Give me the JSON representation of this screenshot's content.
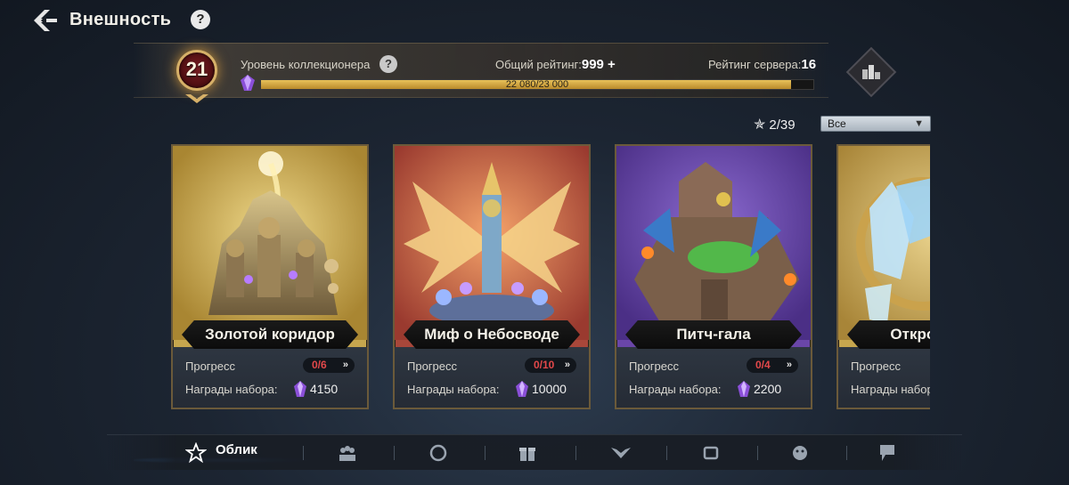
{
  "header": {
    "title": "Внешность",
    "help": "?"
  },
  "collector": {
    "level": "21",
    "label": "Уровень коллекционера",
    "help": "?",
    "overall_rating_label": "Общий рейтинг:",
    "overall_rating_value": "999 +",
    "server_rating_label": "Рейтинг сервера:",
    "server_rating_value": "16",
    "xp_text": "22 080/23 000",
    "xp_progress": 0.96
  },
  "filter": {
    "counter": "2/39",
    "selected": "Все"
  },
  "cards": [
    {
      "name": "Золотой коридор",
      "progress_label": "Прогресс",
      "progress": "0/6",
      "rewards_label": "Награды набора:",
      "reward_value": "4150",
      "theme": "gold"
    },
    {
      "name": "Миф о Небосводе",
      "progress_label": "Прогресс",
      "progress": "0/10",
      "rewards_label": "Награды набора:",
      "reward_value": "10000",
      "theme": "red"
    },
    {
      "name": "Питч-гала",
      "progress_label": "Прогресс",
      "progress": "0/4",
      "rewards_label": "Награды набора:",
      "reward_value": "2200",
      "theme": "purple"
    },
    {
      "name": "Откровения",
      "progress_label": "Прогресс",
      "progress": "",
      "rewards_label": "Награды набора:",
      "reward_value": "",
      "theme": "gold"
    }
  ],
  "nav": {
    "active_label": "Облик",
    "tabs": [
      "star-tab-icon",
      "crowd-tab-icon",
      "ring-tab-icon",
      "gift-tab-icon",
      "wings-tab-icon",
      "frame-tab-icon",
      "face-tab-icon",
      "flag-tab-icon"
    ]
  },
  "colors": {
    "accent_gold": "#d6b068",
    "progress_red": "#e2484a",
    "active_glow": "#5bb0ff"
  }
}
